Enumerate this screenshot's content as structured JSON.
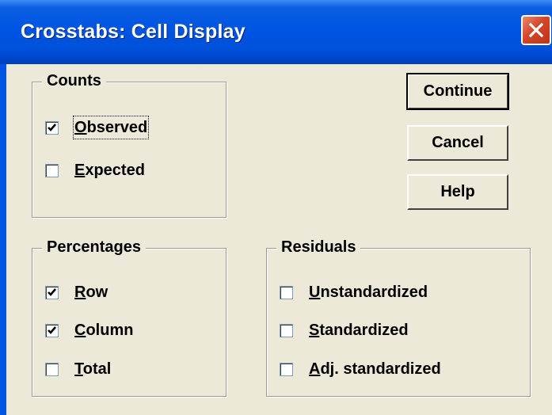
{
  "window": {
    "title": "Crosstabs: Cell Display"
  },
  "counts": {
    "title": "Counts",
    "items": [
      {
        "label": "Observed",
        "mnemonic": "O",
        "rest": "bserved",
        "checked": true
      },
      {
        "label": "Expected",
        "mnemonic": "E",
        "rest": "xpected",
        "checked": false
      }
    ]
  },
  "percentages": {
    "title": "Percentages",
    "items": [
      {
        "label": "Row",
        "mnemonic": "R",
        "rest": "ow",
        "checked": true
      },
      {
        "label": "Column",
        "mnemonic": "C",
        "rest": "olumn",
        "checked": true
      },
      {
        "label": "Total",
        "mnemonic": "T",
        "rest": "otal",
        "checked": false
      }
    ]
  },
  "residuals": {
    "title": "Residuals",
    "items": [
      {
        "label": "Unstandardized",
        "mnemonic": "U",
        "rest": "nstandardized",
        "checked": false
      },
      {
        "label": "Standardized",
        "mnemonic": "S",
        "rest": "tandardized",
        "checked": false
      },
      {
        "label": "Adj. standardized",
        "mnemonic": "A",
        "rest": "dj. standardized",
        "checked": false
      }
    ]
  },
  "buttons": {
    "continue": "Continue",
    "cancel": "Cancel",
    "help": "Help"
  },
  "icons": {
    "check": "check-icon",
    "close": "close-icon"
  },
  "colors": {
    "titlebar": "#0054e3",
    "dialog_bg": "#ece9d8",
    "close_button": "#d4452a"
  }
}
